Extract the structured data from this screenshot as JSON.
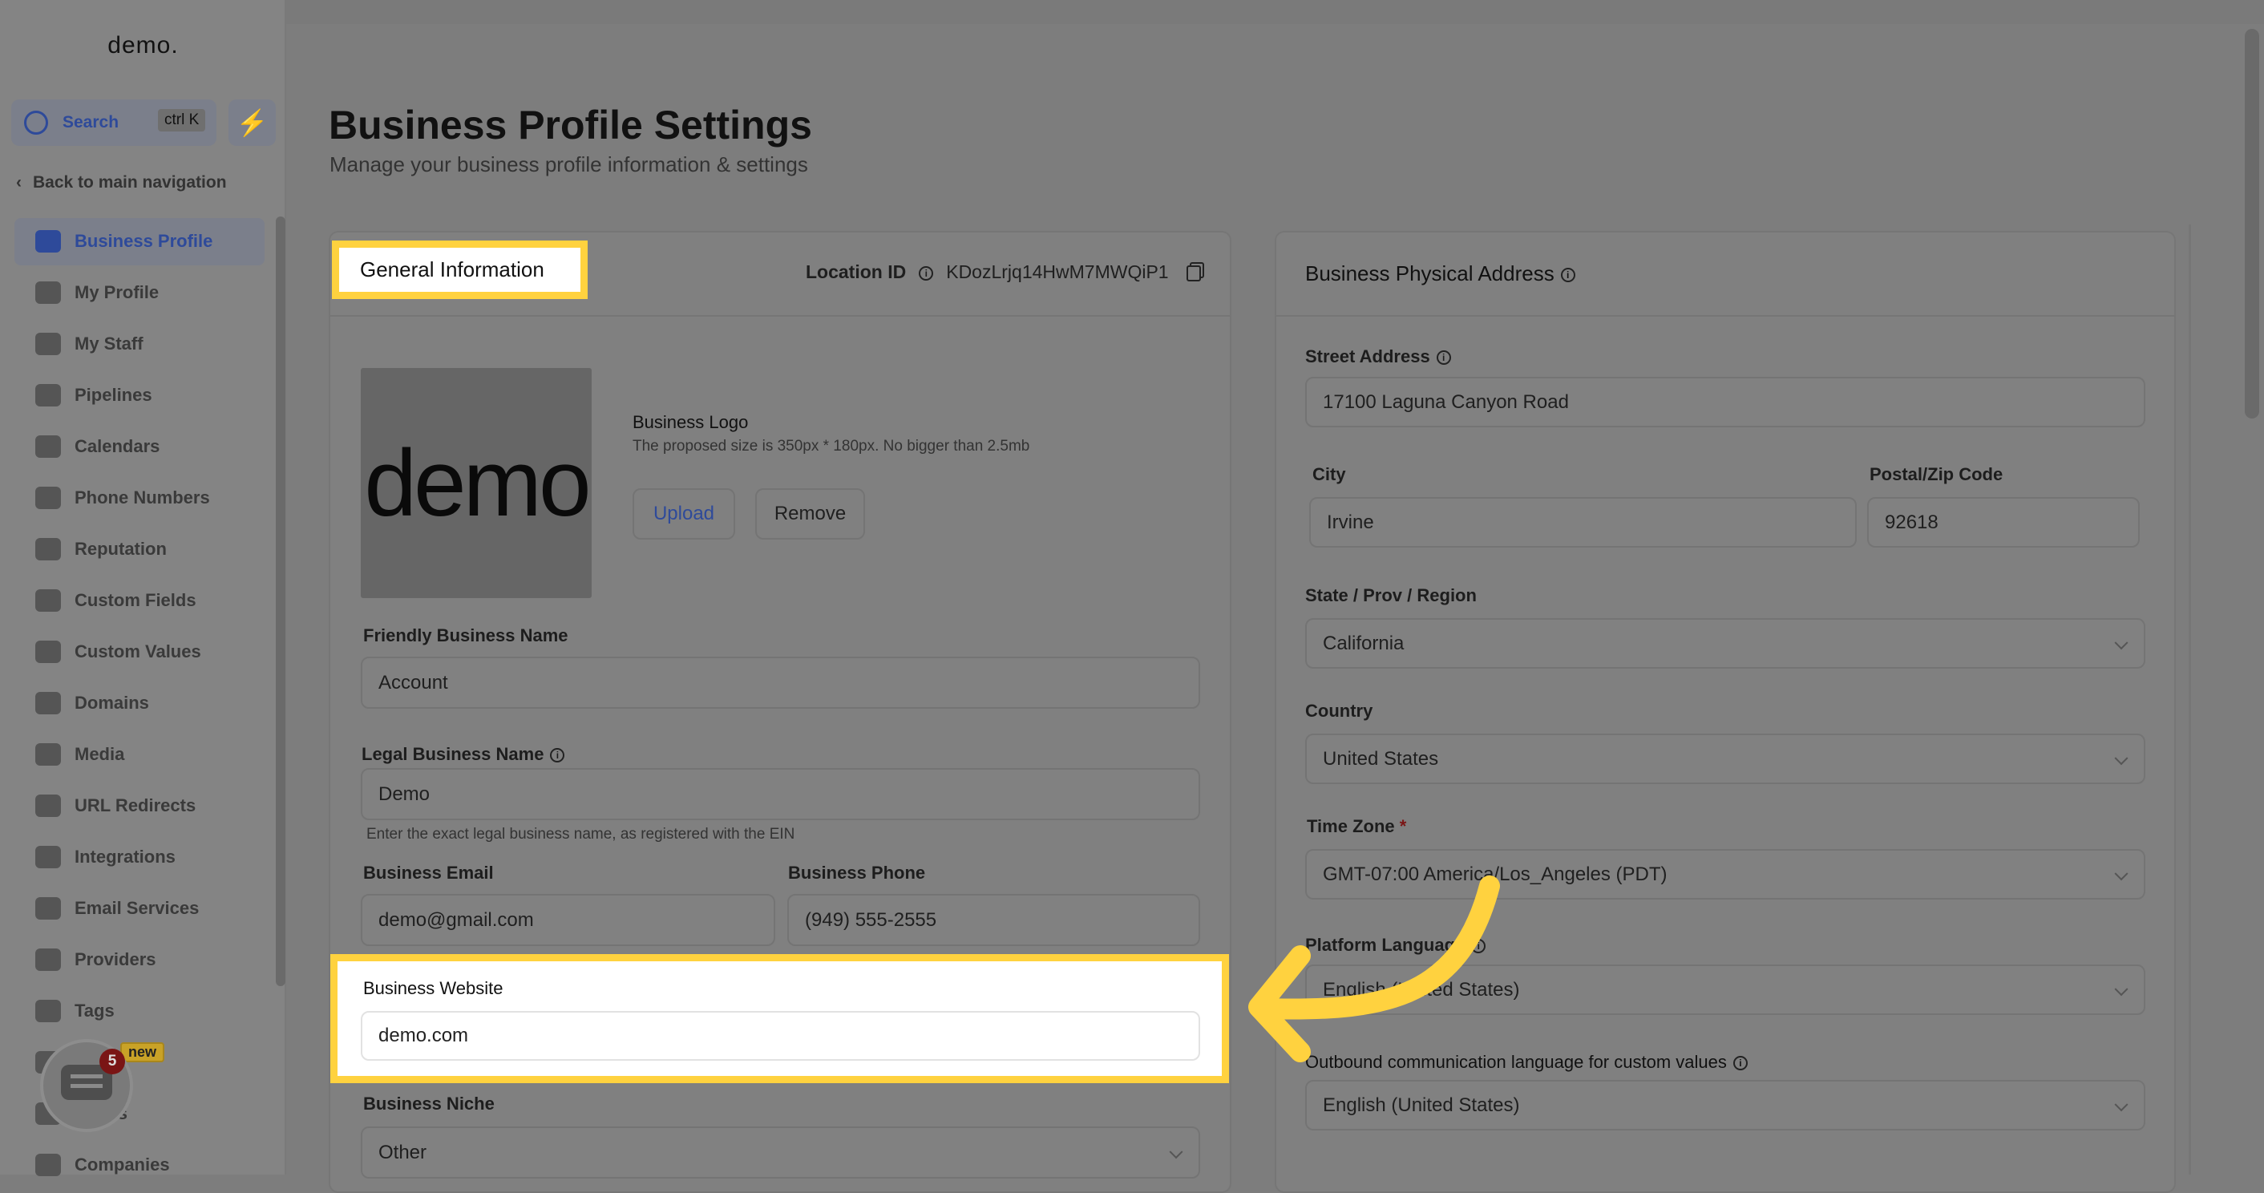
{
  "sidebar": {
    "logo": "demo.",
    "search_label": "Search",
    "search_shortcut": "ctrl K",
    "quick_action_icon": "lightning-icon",
    "back_label": "Back to main navigation",
    "items": [
      {
        "label": "Business Profile",
        "icon": "briefcase-icon",
        "active": true
      },
      {
        "label": "My Profile",
        "icon": "user-circle-icon"
      },
      {
        "label": "My Staff",
        "icon": "user-icon"
      },
      {
        "label": "Pipelines",
        "icon": "funnel-icon"
      },
      {
        "label": "Calendars",
        "icon": "calendar-icon"
      },
      {
        "label": "Phone Numbers",
        "icon": "phone-icon"
      },
      {
        "label": "Reputation",
        "icon": "star-icon"
      },
      {
        "label": "Custom Fields",
        "icon": "fields-icon"
      },
      {
        "label": "Custom Values",
        "icon": "diamond-icon"
      },
      {
        "label": "Domains",
        "icon": "globe-icon"
      },
      {
        "label": "Media",
        "icon": "video-icon"
      },
      {
        "label": "URL Redirects",
        "icon": "redirect-icon"
      },
      {
        "label": "Integrations",
        "icon": "integrations-icon"
      },
      {
        "label": "Email Services",
        "icon": "mail-icon"
      },
      {
        "label": "Providers",
        "icon": "clipboard-icon"
      },
      {
        "label": "Tags",
        "icon": "tag-icon"
      },
      {
        "label": "",
        "icon": "flask-icon"
      },
      {
        "label": "t Logs",
        "icon": "chart-icon"
      },
      {
        "label": "Companies",
        "icon": "flag-icon"
      }
    ],
    "new_badge": "new",
    "chat_badge_count": "5"
  },
  "header": {
    "title": "Business Profile Settings",
    "subtitle": "Manage your business profile information & settings"
  },
  "general": {
    "title": "General Information",
    "location_id_label": "Location ID",
    "location_id": "KDozLrjq14HwM7MWQiP1",
    "logo_text": "demo",
    "logo_label": "Business Logo",
    "logo_hint": "The proposed size is 350px * 180px. No bigger than 2.5mb",
    "upload": "Upload",
    "remove": "Remove",
    "friendly_name_label": "Friendly Business Name",
    "friendly_name": "Account",
    "legal_name_label": "Legal Business Name",
    "legal_name": "Demo",
    "legal_name_hint": "Enter the exact legal business name, as registered with the EIN",
    "email_label": "Business Email",
    "email": "demo@gmail.com",
    "phone_label": "Business Phone",
    "phone": "(949) 555-2555",
    "website_label": "Business Website",
    "website": "demo.com",
    "niche_label": "Business Niche",
    "niche": "Other"
  },
  "address": {
    "title": "Business Physical Address",
    "street_label": "Street Address",
    "street": "17100 Laguna Canyon Road",
    "city_label": "City",
    "city": "Irvine",
    "zip_label": "Postal/Zip Code",
    "zip": "92618",
    "state_label": "State / Prov / Region",
    "state": "California",
    "country_label": "Country",
    "country": "United States",
    "timezone_label": "Time Zone",
    "timezone_required": "*",
    "timezone": "GMT-07:00 America/Los_Angeles (PDT)",
    "platform_language_label": "Platform Language",
    "platform_language": "English (United States)",
    "outbound_language_label": "Outbound communication language for custom values",
    "outbound_language": "English (United States)"
  },
  "colors": {
    "highlight": "#ffd23f",
    "accent": "#2e4a9a"
  }
}
